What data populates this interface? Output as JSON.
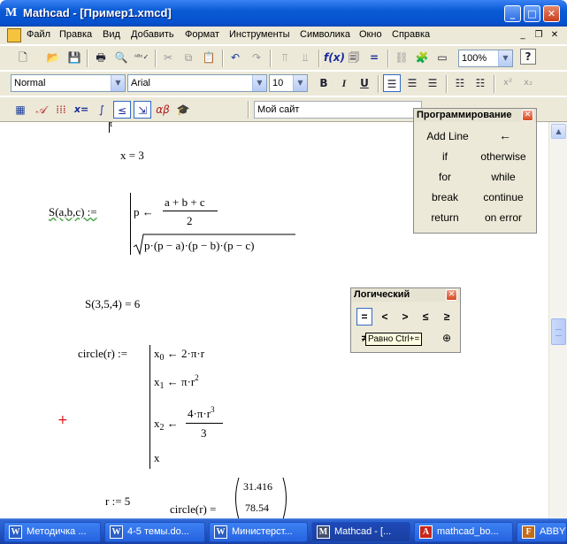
{
  "window": {
    "title": "Mathcad - [Пример1.xmcd]",
    "app_icon": "M"
  },
  "menu": [
    "Файл",
    "Правка",
    "Вид",
    "Добавить",
    "Формат",
    "Инструменты",
    "Символика",
    "Окно",
    "Справка"
  ],
  "standard_toolbar": {
    "zoom": "100%"
  },
  "format_toolbar": {
    "style": "Normal",
    "font": "Arial",
    "size": "10"
  },
  "math_toolbar": {
    "resources_url": "Мой сайт"
  },
  "worksheet": {
    "top_cut": "t",
    "x_assign": "x = 3",
    "s_def_lhs": "S(a,b,c) :=",
    "s_line1_p": "p ←",
    "s_frac_num": "a + b + c",
    "s_frac_den": "2",
    "s_sqrt_body": "p·(p − a)·(p − b)·(p − c)",
    "s_eval": "S(3,5,4) = 6",
    "circle_def_lhs": "circle(r) :=",
    "c_x0_var": "x",
    "c_x0_sub": "0",
    "c_x0_rhs": "← 2·π·r",
    "c_x1_var": "x",
    "c_x1_sub": "1",
    "c_x1_rhs": "← π·r",
    "c_x1_exp": "2",
    "c_x2_var": "x",
    "c_x2_sub": "2",
    "c_x2_arrow": "←",
    "c_x2_num": "4·π·r",
    "c_x2_num_exp": "3",
    "c_x2_den": "3",
    "c_return": "x",
    "r_assign": "r := 5",
    "circle_eval": "circle(r) =",
    "vec": [
      "31.416",
      "78.54"
    ]
  },
  "palette_programming": {
    "title": "Программирование",
    "buttons": [
      "Add Line",
      "←",
      "if",
      "otherwise",
      "for",
      "while",
      "break",
      "continue",
      "return",
      "on error"
    ]
  },
  "palette_logical": {
    "title": "Логический",
    "row1": [
      "=",
      "<",
      ">",
      "≤",
      "≥"
    ],
    "row2_first": "≠",
    "row2_last": "⊕",
    "tooltip": "Равно Ctrl+="
  },
  "taskbar": [
    "Методичка ...",
    "4-5 темы.do...",
    "Министерст...",
    "Mathcad - [...",
    "mathcad_bo...",
    "ABBYY"
  ]
}
